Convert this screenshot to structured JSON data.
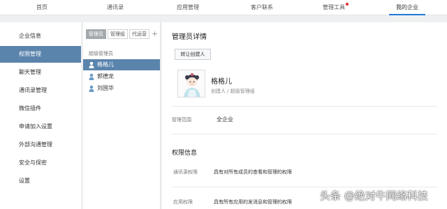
{
  "topnav": {
    "items": [
      "首页",
      "通讯录",
      "应用管理",
      "客户联系",
      "管理工具",
      "我的企业"
    ],
    "active_index": 5,
    "accent": "#1f7ad4",
    "notify_dot_color": "#e02b2b"
  },
  "sidebar": {
    "items": [
      "企业信息",
      "权限管理",
      "聊天管理",
      "通讯录管理",
      "微信插件",
      "申请加入设置",
      "外部沟通管理",
      "安全与保密",
      "设置"
    ],
    "active_index": 1,
    "active_color": "#5b84ad"
  },
  "members": {
    "tabs": [
      "管理员",
      "管理组",
      "代运营"
    ],
    "active_tab": 0,
    "add_icon": "plus-icon",
    "group_title": "超级管理员",
    "list": [
      "格格儿",
      "郭德龙",
      "刘国华"
    ],
    "selected_index": 0
  },
  "detail": {
    "title": "管理员详情",
    "transfer_button": "转让创建人",
    "user": {
      "name": "格格儿",
      "role": "创建人 / 超级管理组"
    },
    "scope": {
      "label": "管理范围",
      "value": "全企业"
    },
    "permissions": {
      "title": "权限信息",
      "rows": [
        {
          "label": "通讯录权限",
          "value": "具有对所有成员的查看和管理的权限"
        },
        {
          "label": "应用权限",
          "value": "具有所有应用的发消息和管理的权限"
        }
      ]
    }
  },
  "watermark": "头条 @绝对牛网络科技"
}
